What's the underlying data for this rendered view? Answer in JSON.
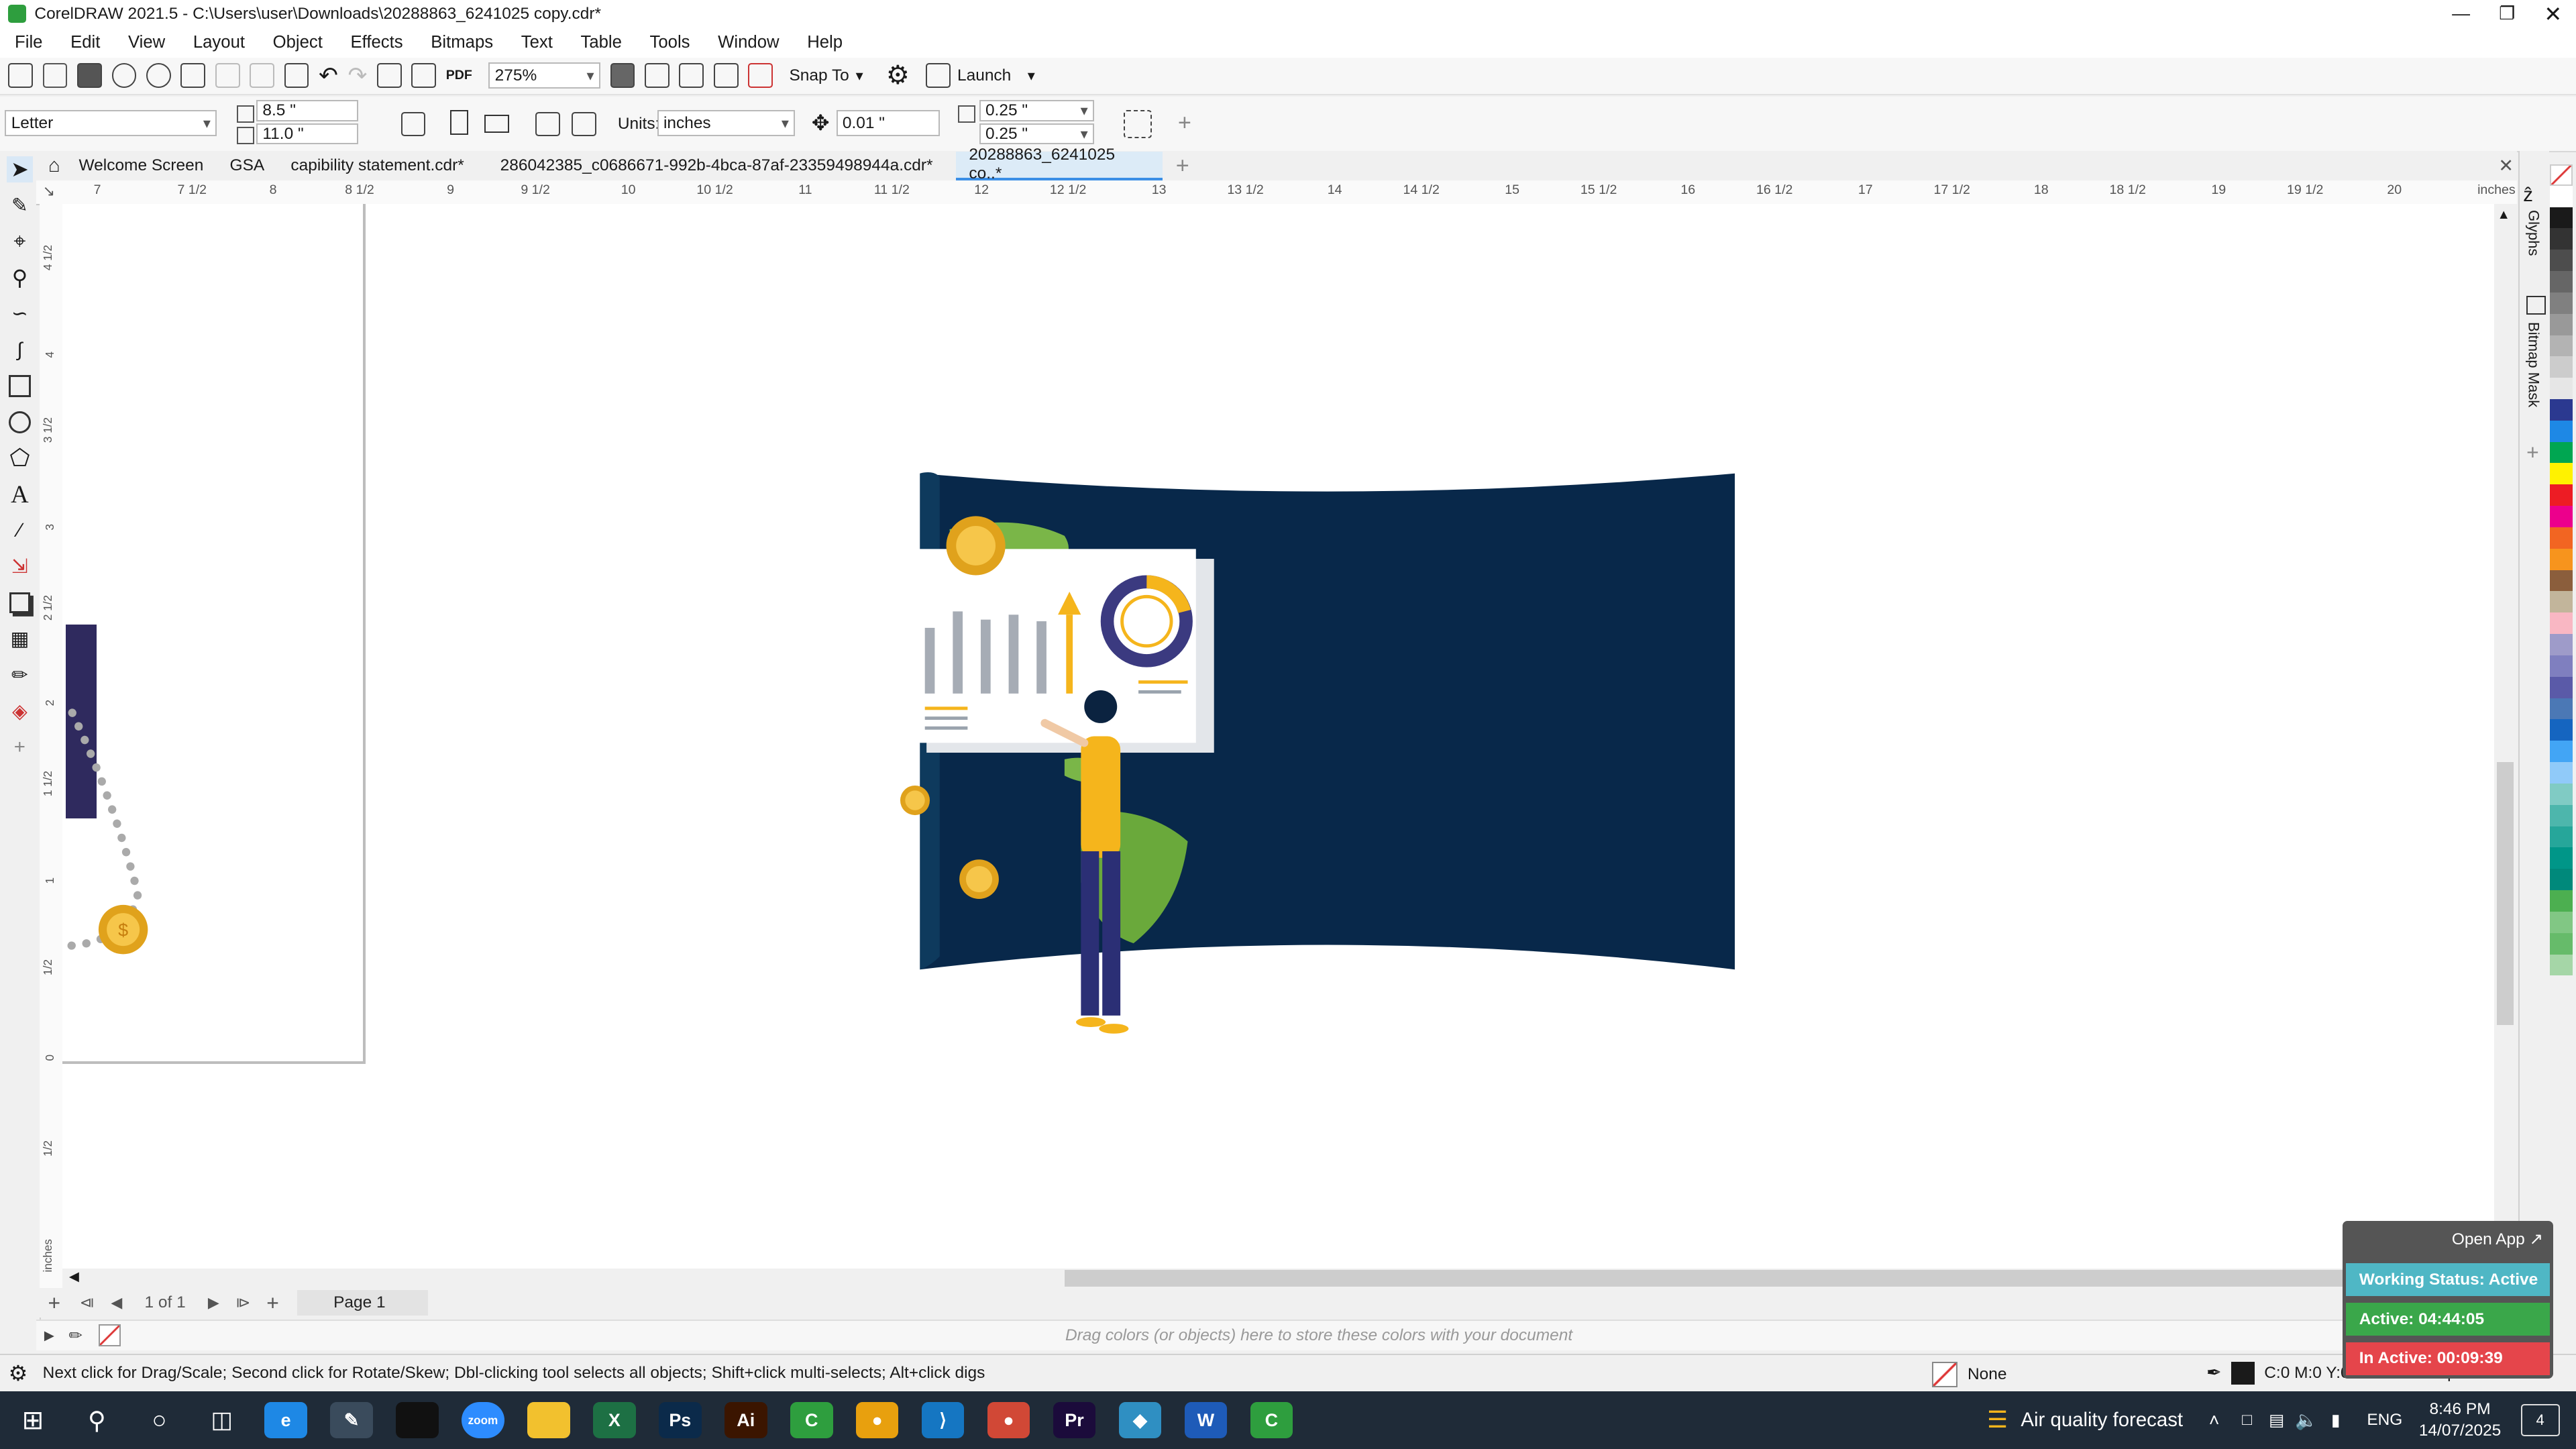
{
  "window": {
    "app_title": "CorelDRAW 2021.5 - C:\\Users\\user\\Downloads\\20288863_6241025 copy.cdr*"
  },
  "menu": [
    "File",
    "Edit",
    "View",
    "Layout",
    "Object",
    "Effects",
    "Bitmaps",
    "Text",
    "Table",
    "Tools",
    "Window",
    "Help"
  ],
  "toolbar": {
    "zoom": "275%",
    "snap_to": "Snap To",
    "launch": "Launch",
    "pdf": "PDF"
  },
  "property_bar": {
    "page_size": "Letter",
    "width": "8.5 \"",
    "height": "11.0 \"",
    "units_label": "Units:",
    "units": "inches",
    "nudge": "0.01 \"",
    "dup_x": "0.25 \"",
    "dup_y": "0.25 \""
  },
  "tabs": [
    {
      "label": "Welcome Screen"
    },
    {
      "label": "GSA"
    },
    {
      "label": "capibility statement.cdr*"
    },
    {
      "label": "286042385_c0686671-992b-4bca-87af-23359498944a.cdr*"
    },
    {
      "label": "20288863_6241025 co..*"
    }
  ],
  "ruler": {
    "h_labels": [
      "7",
      "7 1/2",
      "8",
      "8 1/2",
      "9",
      "9 1/2",
      "10",
      "10 1/2",
      "11",
      "11 1/2",
      "12",
      "12 1/2",
      "13",
      "13 1/2",
      "14",
      "14 1/2",
      "15",
      "15 1/2",
      "16",
      "16 1/2",
      "17",
      "17 1/2",
      "18",
      "18 1/2",
      "19",
      "19 1/2",
      "20"
    ],
    "unit": "inches",
    "v_labels": [
      "4 1/2",
      "4",
      "3 1/2",
      "3",
      "2 1/2",
      "2",
      "1 1/2",
      "1",
      "1/2",
      "0",
      "1/2"
    ]
  },
  "docker": {
    "glyphs": "Glyphs",
    "bitmap_mask": "Bitmap Mask"
  },
  "palette": [
    "#ffffff",
    "#1a1a1a",
    "#333333",
    "#4d4d4d",
    "#666666",
    "#808080",
    "#999999",
    "#b3b3b3",
    "#cccccc",
    "#e6e6e6",
    "#2b3990",
    "#1e88e5",
    "#00a651",
    "#fff200",
    "#ed1c24",
    "#ec008c",
    "#f26522",
    "#f7941d",
    "#8b5e3c",
    "#c2b59b",
    "#f9b7c3",
    "#9e9bc9",
    "#7f7fbf",
    "#5a5aa8",
    "#4b78b5",
    "#1565c0",
    "#42a5f5",
    "#90caf9",
    "#80cbc4",
    "#4db6ac",
    "#26a69a",
    "#009688",
    "#00897b",
    "#4caf50",
    "#81c784",
    "#66bb6a",
    "#a5d6a7"
  ],
  "page_nav": {
    "count": "1 of 1",
    "page_tab": "Page 1"
  },
  "doc_palette_hint": "Drag colors (or objects) here to store these colors with your document",
  "status": {
    "hint": "Next click for Drag/Scale; Second click for Rotate/Skew; Dbl-clicking tool selects all objects; Shift+click multi-selects; Alt+click digs",
    "fill": "None",
    "outline": "C:0 M:0 Y:0 K:100 0.500 pt"
  },
  "tracker": {
    "open_app": "Open App ↗",
    "working": "Working Status: Active",
    "active": "Active: 04:44:05",
    "inactive": "In Active: 00:09:39"
  },
  "taskbar": {
    "weather": "Air quality forecast",
    "lang": "ENG",
    "time": "8:46 PM",
    "date": "14/07/2025",
    "notif": "4",
    "apps": [
      {
        "name": "Edge",
        "color": "#1e88e5",
        "label": "e"
      },
      {
        "name": "Pen",
        "color": "#3a4b5c",
        "label": "✎"
      },
      {
        "name": "Terminal",
        "color": "#111111",
        "label": ""
      },
      {
        "name": "Zoom",
        "color": "#2d8cff",
        "label": "zoom"
      },
      {
        "name": "Explorer",
        "color": "#f2c12e",
        "label": ""
      },
      {
        "name": "Excel",
        "color": "#1d7044",
        "label": "X"
      },
      {
        "name": "Photoshop",
        "color": "#0b2a4a",
        "label": "Ps"
      },
      {
        "name": "Illustrator",
        "color": "#3b1500",
        "label": "Ai"
      },
      {
        "name": "CorelDRAW",
        "color": "#2e9e3e",
        "label": "C"
      },
      {
        "name": "Chrome",
        "color": "#e8a00e",
        "label": "●"
      },
      {
        "name": "VS Code",
        "color": "#1576c2",
        "label": "⟩"
      },
      {
        "name": "Chrome2",
        "color": "#d14836",
        "label": "●"
      },
      {
        "name": "Premiere",
        "color": "#1b0b3b",
        "label": "Pr"
      },
      {
        "name": "App",
        "color": "#2f8fc2",
        "label": "◆"
      },
      {
        "name": "Word",
        "color": "#1e5bb8",
        "label": "W"
      },
      {
        "name": "CorelDRAW2",
        "color": "#2e9e3e",
        "label": "C"
      }
    ]
  }
}
